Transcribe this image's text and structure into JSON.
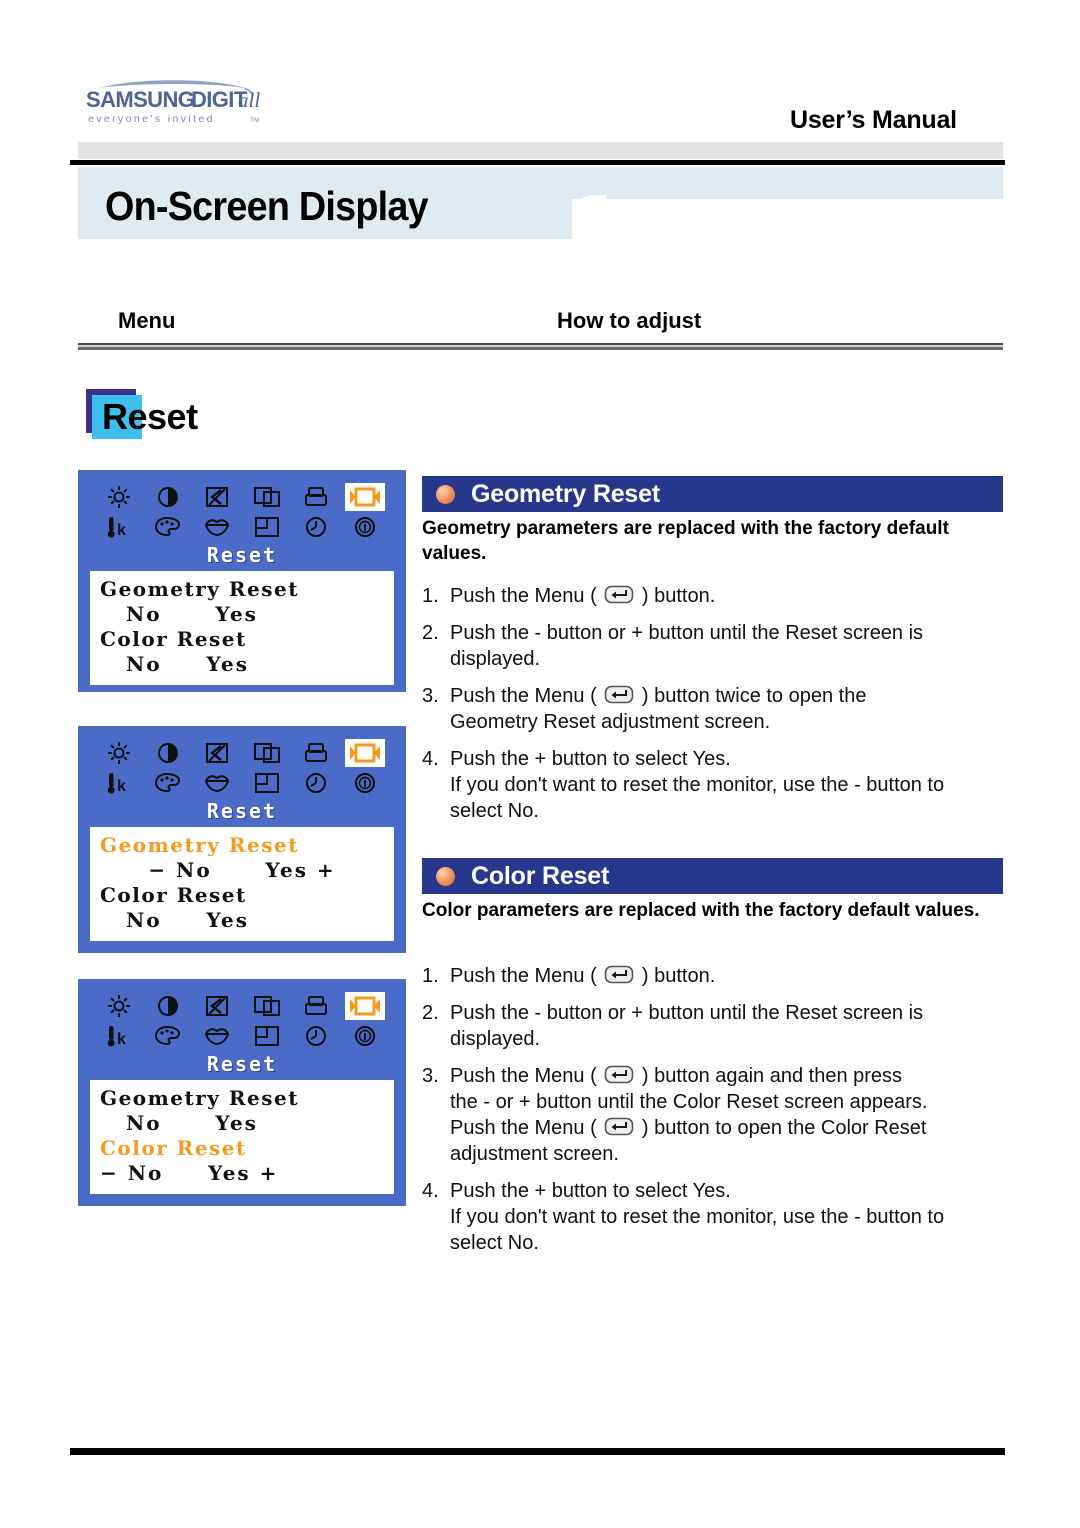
{
  "brand": {
    "logo_main": "SAMSUNG DIGITall",
    "logo_tagline": "everyone's invited",
    "logo_tm": "TM"
  },
  "header": {
    "manual_label": "User’s Manual",
    "page_title": "On-Screen Display"
  },
  "columns": {
    "menu": "Menu",
    "how_to_adjust": "How to adjust"
  },
  "section_chip": {
    "label": "Reset"
  },
  "osd_screens": [
    {
      "title": "Reset",
      "rows": [
        {
          "label": "Geometry Reset",
          "highlighted": false,
          "options": "No      Yes",
          "show_pm": false
        },
        {
          "label": "Color Reset",
          "highlighted": false,
          "options": "No     Yes",
          "show_pm": false
        }
      ]
    },
    {
      "title": "Reset",
      "rows": [
        {
          "label": "Geometry Reset",
          "highlighted": true,
          "options": "− No      Yes +",
          "show_pm": true
        },
        {
          "label": "Color Reset",
          "highlighted": false,
          "options": "No     Yes",
          "show_pm": false
        }
      ]
    },
    {
      "title": "Reset",
      "rows": [
        {
          "label": "Geometry Reset",
          "highlighted": false,
          "options": "No      Yes",
          "show_pm": false
        },
        {
          "label": "Color Reset",
          "highlighted": true,
          "options": "− No     Yes +",
          "show_pm": true
        }
      ]
    }
  ],
  "osd_icons": {
    "row1": [
      "brightness-icon",
      "contrast-icon",
      "moire-icon",
      "position-icon",
      "shape-icon",
      "reset-icon"
    ],
    "row2": [
      "color-temperature-icon",
      "palette-icon",
      "color-tone-icon",
      "zoom-icon",
      "osd-time-icon",
      "information-icon"
    ],
    "selected_index": 5
  },
  "sections": [
    {
      "heading": "Geometry Reset",
      "description": "Geometry parameters are replaced with the factory default values.",
      "steps": [
        {
          "num": "1.",
          "lines": [
            {
              "pre": "Push the Menu ( ",
              "icon": true,
              "post": " ) button."
            }
          ]
        },
        {
          "num": "2.",
          "lines": [
            {
              "pre": "Push the - button or + button until the Reset screen is",
              "icon": false,
              "post": ""
            },
            {
              "pre": "displayed.",
              "icon": false,
              "post": ""
            }
          ]
        },
        {
          "num": "3.",
          "lines": [
            {
              "pre": "Push the Menu ( ",
              "icon": true,
              "post": " ) button twice to open the"
            },
            {
              "pre": "Geometry Reset adjustment screen.",
              "icon": false,
              "post": ""
            }
          ]
        },
        {
          "num": "4.",
          "lines": [
            {
              "pre": "Push the + button to select Yes.",
              "icon": false,
              "post": ""
            },
            {
              "pre": "If you don't want to reset the monitor, use the - button to",
              "icon": false,
              "post": ""
            },
            {
              "pre": "select No.",
              "icon": false,
              "post": ""
            }
          ]
        }
      ]
    },
    {
      "heading": "Color Reset",
      "description": "Color parameters are replaced with the factory default values.",
      "steps": [
        {
          "num": "1.",
          "lines": [
            {
              "pre": "Push the Menu ( ",
              "icon": true,
              "post": " ) button."
            }
          ]
        },
        {
          "num": "2.",
          "lines": [
            {
              "pre": "Push the - button or + button until the Reset screen is",
              "icon": false,
              "post": ""
            },
            {
              "pre": "displayed.",
              "icon": false,
              "post": ""
            }
          ]
        },
        {
          "num": "3.",
          "lines": [
            {
              "pre": "Push the Menu ( ",
              "icon": true,
              "post": " ) button again and then press"
            },
            {
              "pre": " the - or + button until the Color Reset screen appears.",
              "icon": false,
              "post": ""
            },
            {
              "pre": "Push the Menu ( ",
              "icon": true,
              "post": " ) button to open the Color Reset"
            },
            {
              "pre": "adjustment screen.",
              "icon": false,
              "post": ""
            }
          ]
        },
        {
          "num": "4.",
          "lines": [
            {
              "pre": "Push the + button to select Yes.",
              "icon": false,
              "post": ""
            },
            {
              "pre": "If you don't want to reset the monitor, use the - button to",
              "icon": false,
              "post": ""
            },
            {
              "pre": "select No.",
              "icon": false,
              "post": ""
            }
          ]
        }
      ]
    }
  ],
  "colors": {
    "osd_blue": "#4a6bc8",
    "section_header_navy": "#27388c",
    "highlight_orange": "#f59a1e",
    "title_band_blue": "#e0eaf1",
    "chip_cyan": "#3ec0ef",
    "chip_navy": "#3b3188",
    "bullet_orange": "#e07a44"
  }
}
